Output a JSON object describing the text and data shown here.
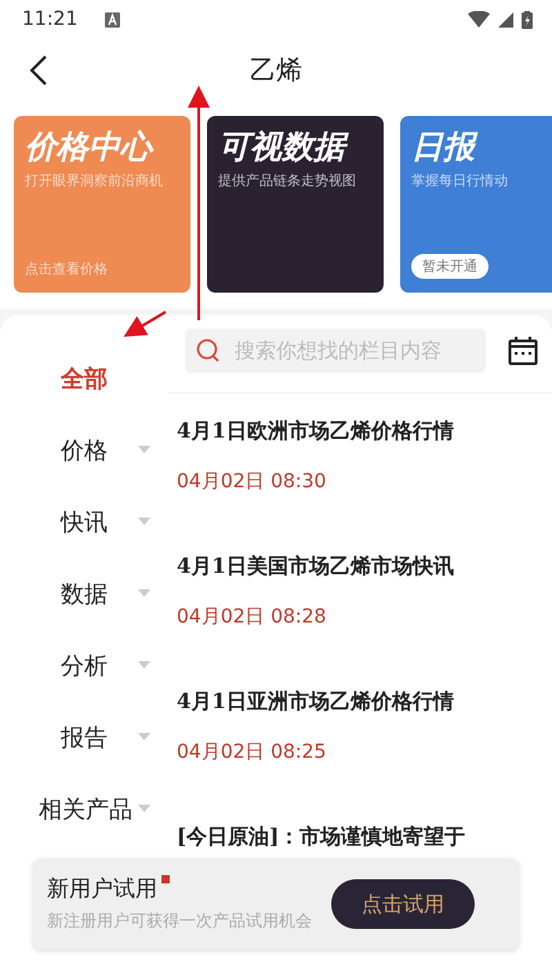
{
  "status_bar": {
    "time": "11:21"
  },
  "header": {
    "title": "乙烯"
  },
  "cards": [
    {
      "title": "价格中心",
      "subtitle": "打开眼界洞察前沿商机",
      "action": "点击查看价格",
      "color": "#ee8a52"
    },
    {
      "title": "可视数据",
      "subtitle": "提供产品链条走势视图",
      "color": "#2a2230"
    },
    {
      "title": "日报",
      "subtitle": "掌握每日行情动",
      "badge": "暂未开通",
      "color": "#3f7fd6"
    }
  ],
  "sidebar": {
    "items": [
      {
        "label": "全部",
        "selected": true,
        "expandable": false
      },
      {
        "label": "价格",
        "selected": false,
        "expandable": true
      },
      {
        "label": "快讯",
        "selected": false,
        "expandable": true
      },
      {
        "label": "数据",
        "selected": false,
        "expandable": true
      },
      {
        "label": "分析",
        "selected": false,
        "expandable": true
      },
      {
        "label": "报告",
        "selected": false,
        "expandable": true
      },
      {
        "label": "相关产品",
        "selected": false,
        "expandable": true
      }
    ]
  },
  "search": {
    "placeholder": "搜索你想找的栏目内容"
  },
  "articles": [
    {
      "title": "4月1日欧洲市场乙烯价格行情",
      "date": "04月02日 08:30"
    },
    {
      "title": "4月1日美国市场乙烯市场快讯",
      "date": "04月02日 08:28"
    },
    {
      "title": "4月1日亚洲市场乙烯价格行情",
      "date": "04月02日 08:25"
    },
    {
      "title": "[今日原油]：市场谨慎地寄望于"
    }
  ],
  "trial_banner": {
    "title": "新用户试用",
    "subtitle": "新注册用户可获得一次产品试用机会",
    "button": "点击试用"
  }
}
